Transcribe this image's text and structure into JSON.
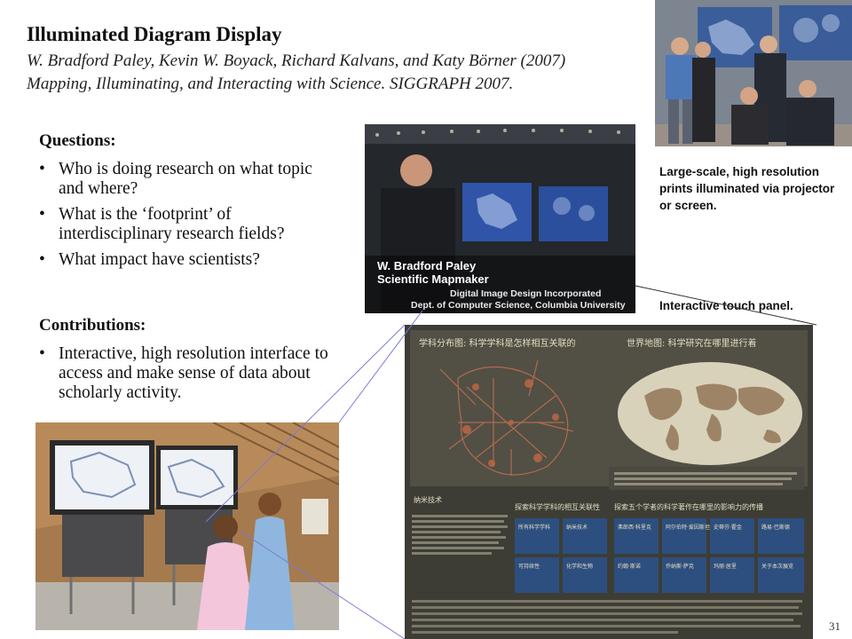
{
  "header": {
    "title": "Illuminated Diagram Display",
    "citation_line1": "W. Bradford Paley, Kevin W. Boyack, Richard Kalvans, and Katy Börner (2007)",
    "citation_line2_italic": "Mapping, Illuminating, and Interacting with Science",
    "citation_line2_rest": ". SIGGRAPH 2007."
  },
  "questions": {
    "heading": "Questions:",
    "items": [
      "Who is doing research on what topic and where?",
      "What is the ‘footprint’ of interdisciplinary research fields?",
      "What impact have scientists?"
    ]
  },
  "contributions": {
    "heading": "Contributions:",
    "items": [
      "Interactive, high resolution interface to access and make sense of data about scholarly activity."
    ]
  },
  "captions": {
    "prints": "Large-scale, high resolution prints illuminated via projector or screen.",
    "panel": "Interactive touch panel."
  },
  "video": {
    "name": "W. Bradford Paley",
    "role": "Scientific Mapmaker",
    "org1": "Digital Image Design Incorporated",
    "org2": "Dept. of Computer Science, Columbia University"
  },
  "panel": {
    "left_map_title": "学科分布图: 科学学科是怎样相互关联的",
    "right_map_title": "世界地图: 科学研究在哪里进行着",
    "section1": "纳米技术",
    "section2": "探索科学学科的相互关联性",
    "section3": "探索五个学者的科学著作在哪里的影响力的传播",
    "tiles": [
      "所有科学学科",
      "纳米技术",
      "可持续性",
      "化学和生物",
      "弗郎西·科里克",
      "阿尔伯特·爱因斯坦",
      "史蒂芬·霍金",
      "路易·巴斯德",
      "约翰·斯诺",
      "乔纳斯·萨克",
      "玛丽·居里",
      "关于本次展览"
    ]
  },
  "page_number": "31"
}
